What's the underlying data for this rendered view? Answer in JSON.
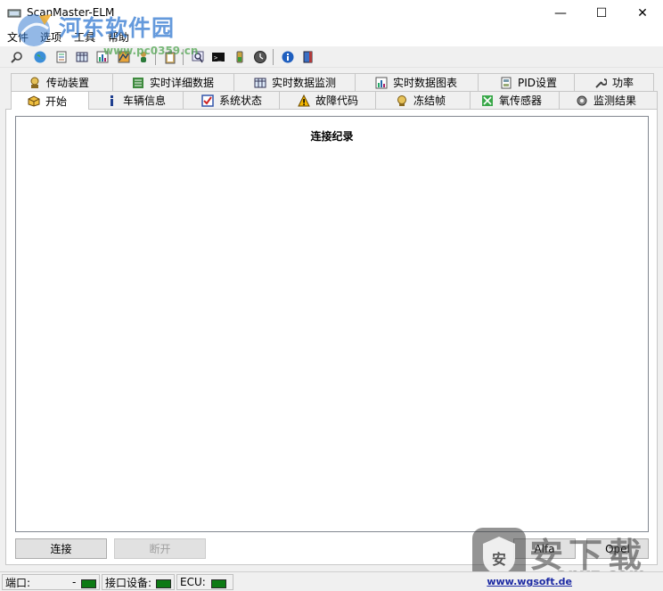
{
  "window": {
    "title": "ScanMaster-ELM",
    "minimize": "—",
    "maximize": "☐",
    "close": "✕"
  },
  "menu": [
    "文件",
    "选项",
    "工具",
    "帮助"
  ],
  "watermark": {
    "brand": "河东软件园",
    "url": "www.pc0359.cn"
  },
  "toolbar_icons": [
    "search-icon",
    "globe-icon",
    "document-icon",
    "grid-icon",
    "chart-icon",
    "map-icon",
    "person-icon",
    "clipboard-icon",
    "magnifier-icon",
    "terminal-icon",
    "battery-icon",
    "clock-icon",
    "info-icon",
    "book-icon"
  ],
  "tabs_back": [
    {
      "label": "传动装置",
      "icon": "transmission-icon"
    },
    {
      "label": "实时详细数据",
      "icon": "list-icon"
    },
    {
      "label": "实时数据监测",
      "icon": "table-icon"
    },
    {
      "label": "实时数据图表",
      "icon": "chart-icon"
    },
    {
      "label": "PID设置",
      "icon": "pid-icon"
    },
    {
      "label": "功率",
      "icon": "wrench-icon"
    }
  ],
  "tabs_front": [
    {
      "label": "开始",
      "icon": "box-icon"
    },
    {
      "label": "车辆信息",
      "icon": "info-icon"
    },
    {
      "label": "系统状态",
      "icon": "checkbox-icon"
    },
    {
      "label": "故障代码",
      "icon": "warning-icon"
    },
    {
      "label": "冻结帧",
      "icon": "freeze-icon"
    },
    {
      "label": "氧传感器",
      "icon": "sensor-icon"
    },
    {
      "label": "监测结果",
      "icon": "gear-icon"
    }
  ],
  "active_tab": "开始",
  "log": {
    "title": "连接纪录"
  },
  "buttons": {
    "connect": "连接",
    "disconnect": "断开",
    "alfa": "Alfa",
    "opel": "Opel"
  },
  "status": {
    "port_label": "端口:",
    "port_value": "-",
    "interface_label": "接口设备:",
    "ecu_label": "ECU:",
    "link": "www.wgsoft.de"
  },
  "download_watermark": {
    "text": "安下载",
    "url": "anxz.com"
  },
  "colors": {
    "led": "#0d7a14",
    "link": "#1c2aa4",
    "watermark_blue": "#3a7ed2"
  }
}
